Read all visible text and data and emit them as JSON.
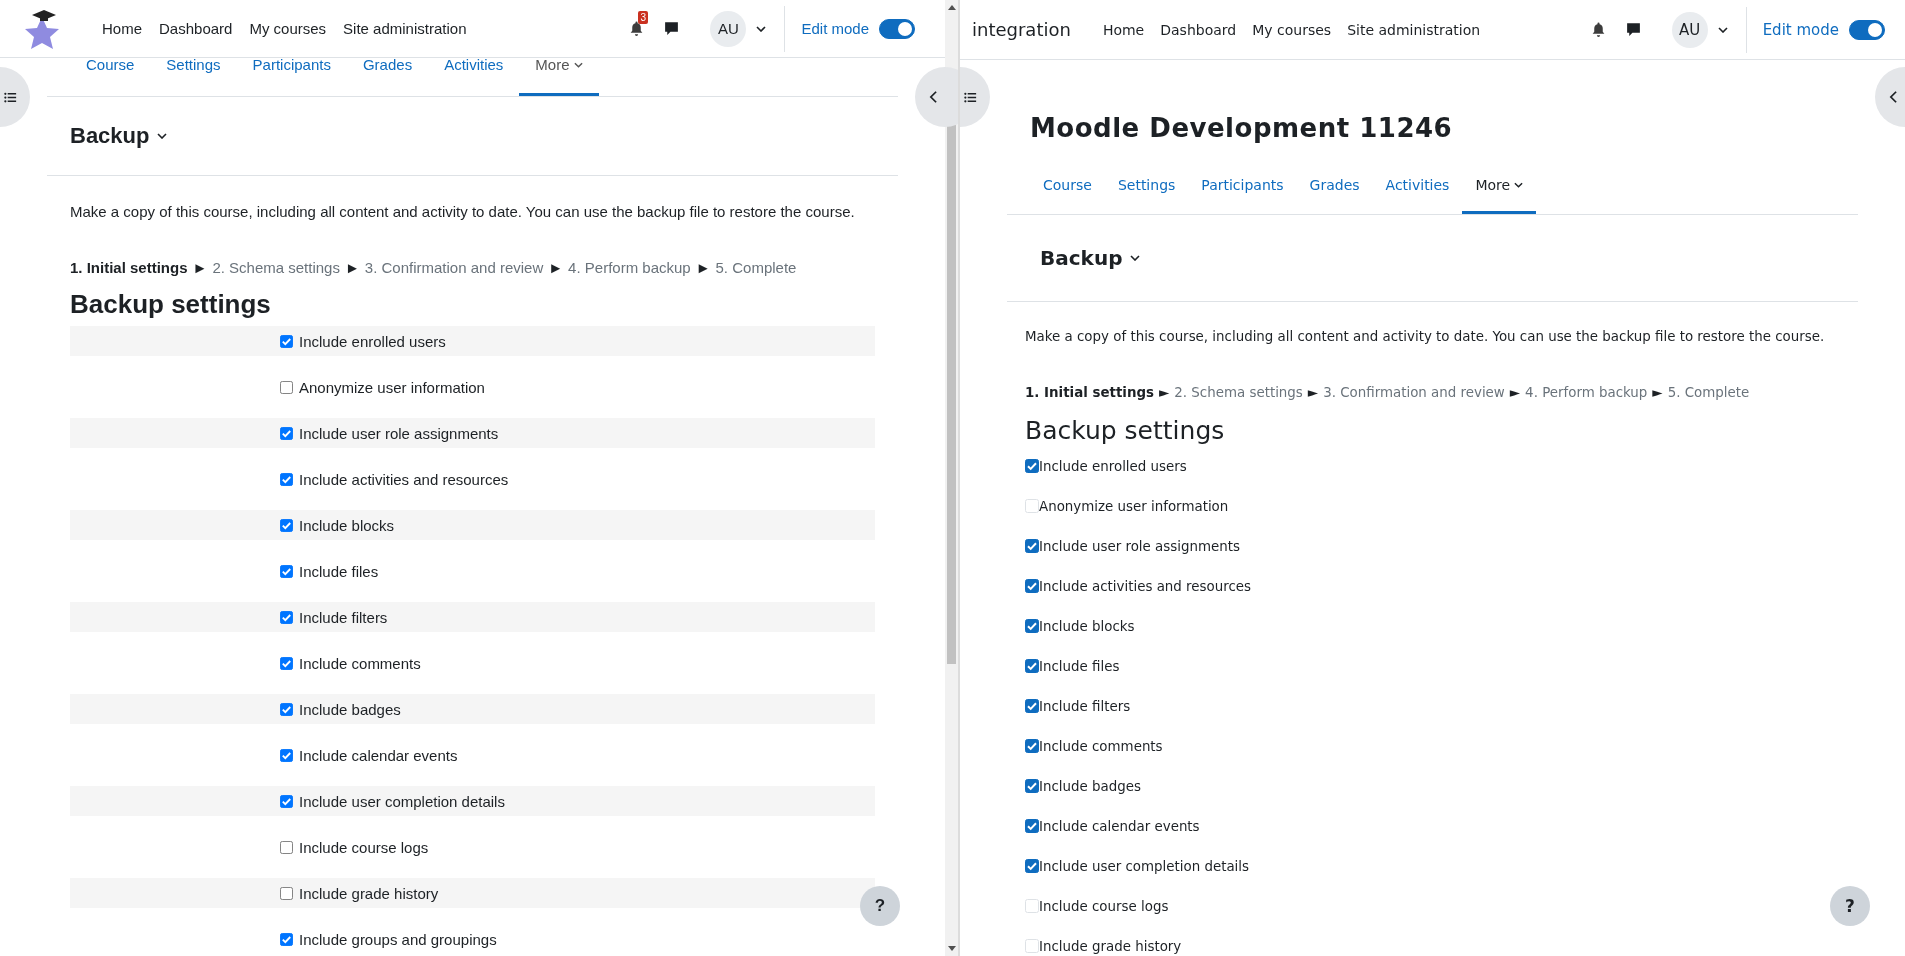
{
  "panes": [
    {
      "brand": {
        "kind": "logo"
      },
      "nav": [
        "Home",
        "Dashboard",
        "My courses",
        "Site administration"
      ],
      "notifications": {
        "count": "3"
      },
      "avatar": "AU",
      "edit_mode": {
        "label": "Edit mode",
        "on": true
      },
      "tabs": [
        {
          "label": "Course",
          "selected": false
        },
        {
          "label": "Settings",
          "selected": false
        },
        {
          "label": "Participants",
          "selected": false
        },
        {
          "label": "Grades",
          "selected": false
        },
        {
          "label": "Activities",
          "selected": false
        },
        {
          "label": "More",
          "selected": true
        }
      ],
      "heading": "Backup",
      "description": "Make a copy of this course, including all content and activity to date. You can use the backup file to restore the course.",
      "steps": [
        {
          "label": "1. Initial settings",
          "selected": true
        },
        {
          "label": "2. Schema settings",
          "selected": false
        },
        {
          "label": "3. Confirmation and review",
          "selected": false
        },
        {
          "label": "4. Perform backup",
          "selected": false
        },
        {
          "label": "5. Complete",
          "selected": false
        }
      ],
      "separators": [
        "►",
        "►",
        "►",
        "►"
      ],
      "section_title": "Backup settings",
      "settings": [
        {
          "label": "Include enrolled users",
          "checked": true
        },
        {
          "label": "Anonymize user information",
          "checked": false
        },
        {
          "label": "Include user role assignments",
          "checked": true
        },
        {
          "label": "Include activities and resources",
          "checked": true
        },
        {
          "label": "Include blocks",
          "checked": true
        },
        {
          "label": "Include files",
          "checked": true
        },
        {
          "label": "Include filters",
          "checked": true
        },
        {
          "label": "Include comments",
          "checked": true
        },
        {
          "label": "Include badges",
          "checked": true
        },
        {
          "label": "Include calendar events",
          "checked": true
        },
        {
          "label": "Include user completion details",
          "checked": true
        },
        {
          "label": "Include course logs",
          "checked": false
        },
        {
          "label": "Include grade history",
          "checked": false
        },
        {
          "label": "Include groups and groupings",
          "checked": true
        }
      ],
      "help": "?"
    },
    {
      "brand": {
        "kind": "text",
        "text": "integration"
      },
      "nav": [
        "Home",
        "Dashboard",
        "My courses",
        "Site administration"
      ],
      "avatar": "AU",
      "edit_mode": {
        "label": "Edit mode",
        "on": true
      },
      "course_title": "Moodle Development 11246",
      "tabs": [
        {
          "label": "Course",
          "selected": false
        },
        {
          "label": "Settings",
          "selected": false
        },
        {
          "label": "Participants",
          "selected": false
        },
        {
          "label": "Grades",
          "selected": false
        },
        {
          "label": "Activities",
          "selected": false
        },
        {
          "label": "More",
          "selected": true
        }
      ],
      "heading": "Backup",
      "description": "Make a copy of this course, including all content and activity to date. You can use the backup file to restore the course.",
      "steps": [
        {
          "label": "1. Initial settings",
          "selected": true
        },
        {
          "label": "2. Schema settings",
          "selected": false
        },
        {
          "label": "3. Confirmation and review",
          "selected": false
        },
        {
          "label": "4. Perform backup",
          "selected": false
        },
        {
          "label": "5. Complete",
          "selected": false
        }
      ],
      "separators": [
        "►",
        "►",
        "►",
        "►"
      ],
      "section_title": "Backup settings",
      "settings": [
        {
          "label": "Include enrolled users",
          "checked": true
        },
        {
          "label": "Anonymize user information",
          "checked": false
        },
        {
          "label": "Include user role assignments",
          "checked": true
        },
        {
          "label": "Include activities and resources",
          "checked": true
        },
        {
          "label": "Include blocks",
          "checked": true
        },
        {
          "label": "Include files",
          "checked": true
        },
        {
          "label": "Include filters",
          "checked": true
        },
        {
          "label": "Include comments",
          "checked": true
        },
        {
          "label": "Include badges",
          "checked": true
        },
        {
          "label": "Include calendar events",
          "checked": true
        },
        {
          "label": "Include user completion details",
          "checked": true
        },
        {
          "label": "Include course logs",
          "checked": false
        },
        {
          "label": "Include grade history",
          "checked": false
        }
      ],
      "help": "?"
    }
  ]
}
